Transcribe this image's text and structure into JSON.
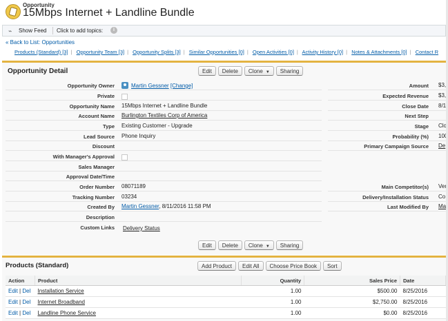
{
  "header": {
    "object_type": "Opportunity",
    "title": "15Mbps Internet + Landline Bundle"
  },
  "chatter": {
    "show_feed": "Show Feed",
    "topics": "Click to add topics:",
    "info_icon": "i"
  },
  "back_link": "« Back to List: Opportunities",
  "related_links": [
    "Products (Standard) [3]",
    "Opportunity Team [3]",
    "Opportunity Splits [3]",
    "Similar Opportunities [0]",
    "Open Activities [0]",
    "Activity History [0]",
    "Notes & Attachments [0]",
    "Contact R"
  ],
  "detail": {
    "title": "Opportunity Detail",
    "buttons": {
      "edit": "Edit",
      "delete": "Delete",
      "clone": "Clone",
      "clone_caret": "▼",
      "sharing": "Sharing"
    },
    "left": [
      {
        "label": "Opportunity Owner",
        "value": "Martin Gessner",
        "extra": "[Change]"
      },
      {
        "label": "Private",
        "value": ""
      },
      {
        "label": "Opportunity Name",
        "value": "15Mbps Internet + Landline Bundle"
      },
      {
        "label": "Account Name",
        "value": "Burlington Textiles Corp of America"
      },
      {
        "label": "Type",
        "value": "Existing Customer - Upgrade"
      },
      {
        "label": "Lead Source",
        "value": "Phone Inquiry"
      },
      {
        "label": "Discount",
        "value": ""
      },
      {
        "label": "With Manager's Approval",
        "value": ""
      },
      {
        "label": "Sales Manager",
        "value": ""
      },
      {
        "label": "Approval Date/Time",
        "value": ""
      },
      {
        "label": "Order Number",
        "value": "08071189"
      },
      {
        "label": "Tracking Number",
        "value": "03234"
      },
      {
        "label": "Created By",
        "value": "Martin Gessner",
        "extra": ", 8/11/2016 11:58 PM"
      },
      {
        "label": "Description",
        "value": ""
      },
      {
        "label": "Custom Links",
        "value": "Delivery Status"
      }
    ],
    "right": [
      {
        "label": "Amount",
        "value": "$3,"
      },
      {
        "label": "Expected Revenue",
        "value": "$3,"
      },
      {
        "label": "Close Date",
        "value": "8/1"
      },
      {
        "label": "Next Step",
        "value": ""
      },
      {
        "label": "Stage",
        "value": "Clo"
      },
      {
        "label": "Probability (%)",
        "value": "100"
      },
      {
        "label": "Primary Campaign Source",
        "value": "De"
      },
      {
        "label": "Main Competitor(s)",
        "value": "Ver"
      },
      {
        "label": "Delivery/Installation Status",
        "value": "Co"
      },
      {
        "label": "Last Modified By",
        "value": "Ma"
      }
    ]
  },
  "products": {
    "title": "Products (Standard)",
    "buttons": {
      "add": "Add Product",
      "edit_all": "Edit All",
      "choose": "Choose Price Book",
      "sort": "Sort"
    },
    "columns": [
      "Action",
      "Product",
      "Quantity",
      "Sales Price",
      "Date"
    ],
    "edit": "Edit",
    "del": "Del",
    "rows": [
      {
        "product": "Installation Service",
        "quantity": "1.00",
        "price": "$500.00",
        "date": "8/25/2016"
      },
      {
        "product": "Internet Broadband",
        "quantity": "1.00",
        "price": "$2,750.00",
        "date": "8/25/2016"
      },
      {
        "product": "Landline Phone Service",
        "quantity": "1.00",
        "price": "$0.00",
        "date": "8/25/2016"
      }
    ]
  }
}
